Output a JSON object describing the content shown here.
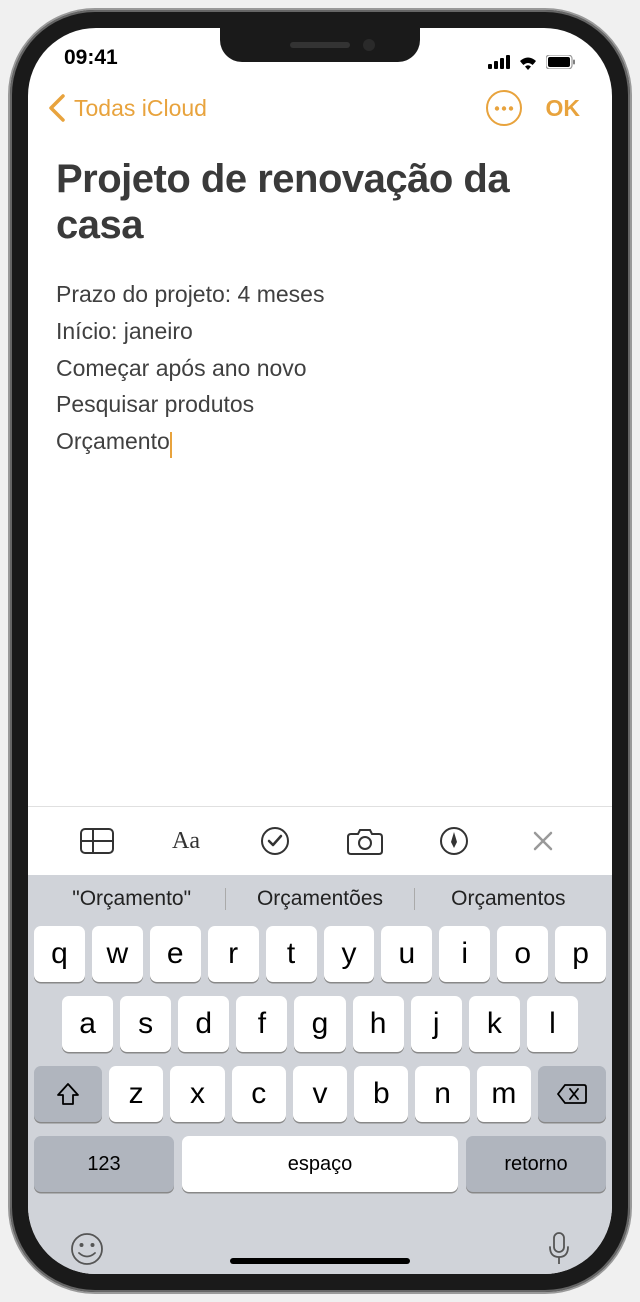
{
  "status": {
    "time": "09:41"
  },
  "nav": {
    "back_label": "Todas iCloud",
    "ok_label": "OK"
  },
  "note": {
    "title": "Projeto de renovação da casa",
    "lines": [
      "Prazo do projeto: 4 meses",
      "Início: janeiro",
      "Começar após ano novo",
      "Pesquisar produtos",
      "Orçamento"
    ]
  },
  "suggestions": [
    "\"Orçamento\"",
    "Orçamentões",
    "Orçamentos"
  ],
  "keyboard": {
    "row1": [
      "q",
      "w",
      "e",
      "r",
      "t",
      "y",
      "u",
      "i",
      "o",
      "p"
    ],
    "row2": [
      "a",
      "s",
      "d",
      "f",
      "g",
      "h",
      "j",
      "k",
      "l"
    ],
    "row3": [
      "z",
      "x",
      "c",
      "v",
      "b",
      "n",
      "m"
    ],
    "numeric": "123",
    "space": "espaço",
    "return": "retorno"
  }
}
